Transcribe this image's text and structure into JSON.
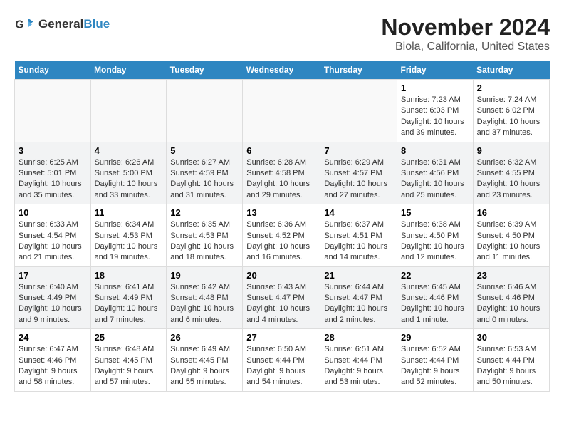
{
  "header": {
    "logo_general": "General",
    "logo_blue": "Blue",
    "title": "November 2024",
    "subtitle": "Biola, California, United States"
  },
  "days_of_week": [
    "Sunday",
    "Monday",
    "Tuesday",
    "Wednesday",
    "Thursday",
    "Friday",
    "Saturday"
  ],
  "weeks": [
    [
      {
        "day": "",
        "info": ""
      },
      {
        "day": "",
        "info": ""
      },
      {
        "day": "",
        "info": ""
      },
      {
        "day": "",
        "info": ""
      },
      {
        "day": "",
        "info": ""
      },
      {
        "day": "1",
        "info": "Sunrise: 7:23 AM\nSunset: 6:03 PM\nDaylight: 10 hours and 39 minutes."
      },
      {
        "day": "2",
        "info": "Sunrise: 7:24 AM\nSunset: 6:02 PM\nDaylight: 10 hours and 37 minutes."
      }
    ],
    [
      {
        "day": "3",
        "info": "Sunrise: 6:25 AM\nSunset: 5:01 PM\nDaylight: 10 hours and 35 minutes."
      },
      {
        "day": "4",
        "info": "Sunrise: 6:26 AM\nSunset: 5:00 PM\nDaylight: 10 hours and 33 minutes."
      },
      {
        "day": "5",
        "info": "Sunrise: 6:27 AM\nSunset: 4:59 PM\nDaylight: 10 hours and 31 minutes."
      },
      {
        "day": "6",
        "info": "Sunrise: 6:28 AM\nSunset: 4:58 PM\nDaylight: 10 hours and 29 minutes."
      },
      {
        "day": "7",
        "info": "Sunrise: 6:29 AM\nSunset: 4:57 PM\nDaylight: 10 hours and 27 minutes."
      },
      {
        "day": "8",
        "info": "Sunrise: 6:31 AM\nSunset: 4:56 PM\nDaylight: 10 hours and 25 minutes."
      },
      {
        "day": "9",
        "info": "Sunrise: 6:32 AM\nSunset: 4:55 PM\nDaylight: 10 hours and 23 minutes."
      }
    ],
    [
      {
        "day": "10",
        "info": "Sunrise: 6:33 AM\nSunset: 4:54 PM\nDaylight: 10 hours and 21 minutes."
      },
      {
        "day": "11",
        "info": "Sunrise: 6:34 AM\nSunset: 4:53 PM\nDaylight: 10 hours and 19 minutes."
      },
      {
        "day": "12",
        "info": "Sunrise: 6:35 AM\nSunset: 4:53 PM\nDaylight: 10 hours and 18 minutes."
      },
      {
        "day": "13",
        "info": "Sunrise: 6:36 AM\nSunset: 4:52 PM\nDaylight: 10 hours and 16 minutes."
      },
      {
        "day": "14",
        "info": "Sunrise: 6:37 AM\nSunset: 4:51 PM\nDaylight: 10 hours and 14 minutes."
      },
      {
        "day": "15",
        "info": "Sunrise: 6:38 AM\nSunset: 4:50 PM\nDaylight: 10 hours and 12 minutes."
      },
      {
        "day": "16",
        "info": "Sunrise: 6:39 AM\nSunset: 4:50 PM\nDaylight: 10 hours and 11 minutes."
      }
    ],
    [
      {
        "day": "17",
        "info": "Sunrise: 6:40 AM\nSunset: 4:49 PM\nDaylight: 10 hours and 9 minutes."
      },
      {
        "day": "18",
        "info": "Sunrise: 6:41 AM\nSunset: 4:49 PM\nDaylight: 10 hours and 7 minutes."
      },
      {
        "day": "19",
        "info": "Sunrise: 6:42 AM\nSunset: 4:48 PM\nDaylight: 10 hours and 6 minutes."
      },
      {
        "day": "20",
        "info": "Sunrise: 6:43 AM\nSunset: 4:47 PM\nDaylight: 10 hours and 4 minutes."
      },
      {
        "day": "21",
        "info": "Sunrise: 6:44 AM\nSunset: 4:47 PM\nDaylight: 10 hours and 2 minutes."
      },
      {
        "day": "22",
        "info": "Sunrise: 6:45 AM\nSunset: 4:46 PM\nDaylight: 10 hours and 1 minute."
      },
      {
        "day": "23",
        "info": "Sunrise: 6:46 AM\nSunset: 4:46 PM\nDaylight: 10 hours and 0 minutes."
      }
    ],
    [
      {
        "day": "24",
        "info": "Sunrise: 6:47 AM\nSunset: 4:46 PM\nDaylight: 9 hours and 58 minutes."
      },
      {
        "day": "25",
        "info": "Sunrise: 6:48 AM\nSunset: 4:45 PM\nDaylight: 9 hours and 57 minutes."
      },
      {
        "day": "26",
        "info": "Sunrise: 6:49 AM\nSunset: 4:45 PM\nDaylight: 9 hours and 55 minutes."
      },
      {
        "day": "27",
        "info": "Sunrise: 6:50 AM\nSunset: 4:44 PM\nDaylight: 9 hours and 54 minutes."
      },
      {
        "day": "28",
        "info": "Sunrise: 6:51 AM\nSunset: 4:44 PM\nDaylight: 9 hours and 53 minutes."
      },
      {
        "day": "29",
        "info": "Sunrise: 6:52 AM\nSunset: 4:44 PM\nDaylight: 9 hours and 52 minutes."
      },
      {
        "day": "30",
        "info": "Sunrise: 6:53 AM\nSunset: 4:44 PM\nDaylight: 9 hours and 50 minutes."
      }
    ]
  ]
}
